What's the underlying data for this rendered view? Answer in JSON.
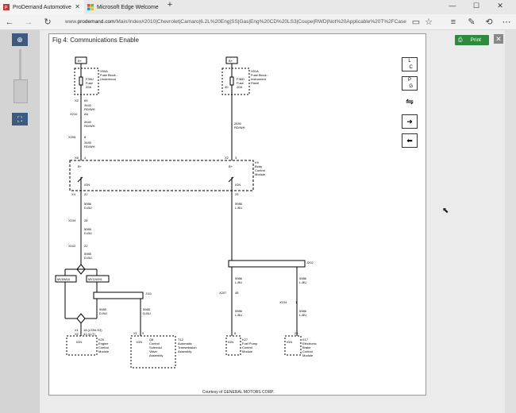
{
  "browser": {
    "tabs": [
      {
        "label": "ProDemand Automotive",
        "icon": "prodemand-icon"
      },
      {
        "label": "Microsoft Edge Welcome",
        "icon": "windows-icon"
      }
    ],
    "new_tab": "+",
    "url_prefix": "www.",
    "url_domain": "prodemand.com",
    "url_rest": "/Main/Index#2010|Chevrolet|Camaro|6.2L%20Eng|SS|Gas|Eng%20CD%20LS3|Coupe|RWD|Not%20Applicable%20T%2FCase"
  },
  "toolbar": {
    "print_label": "Print",
    "close_symbol": "✕"
  },
  "figure": {
    "title": "Fig 4: Communications Enable",
    "courtesy": "Courtesy of GENERAL MOTORS CORP."
  },
  "side_tools": [
    "LOC",
    "PEG",
    "connector-icon",
    "arrow-right-icon",
    "arrow-left-icon"
  ],
  "diagram": {
    "b_plus": "B+",
    "fuse_left": {
      "ref": "X50A",
      "desc1": "Fuse Block -",
      "desc2": "Underhood",
      "fuse_id": "F39U",
      "fuse": "Fuse",
      "amps": "20A"
    },
    "fuse_right": {
      "ref": "X51A",
      "desc1": "Fuse Block -",
      "desc2": "Instrument",
      "desc3": "Panel",
      "fuse_id": "F36D",
      "fuse": "Fuse",
      "amps": "20A",
      "pin": "40"
    },
    "left_conn": [
      {
        "conn": "X2",
        "pin": "69"
      },
      {
        "conn": "X210",
        "pin": "A5"
      },
      {
        "conn": "X206",
        "pin": "8"
      },
      {
        "conn": "X8",
        "pin": "4"
      }
    ],
    "left_wires": [
      {
        "circuit": "3440",
        "color": "RD/WH"
      },
      {
        "circuit": "3440",
        "color": "RD/WH"
      },
      {
        "circuit": "3440",
        "color": "RD/WH"
      }
    ],
    "right_wire": {
      "circuit": "2640",
      "color": "RD/WH"
    },
    "right_conn": {
      "conn": "X2",
      "pin": "3"
    },
    "k9": {
      "ref": "K9",
      "line1": "Body",
      "line2": "Control",
      "line3": "Module",
      "bplus1": "B+",
      "bplus2": "B+",
      "ign1": "IGN",
      "ign2": "IGN"
    },
    "x4": {
      "conn": "X4",
      "pin_left": "22",
      "pin_right": "25"
    },
    "wire_5986_a": {
      "circuit": "5986",
      "color": "D-BU"
    },
    "wire_5986_r": {
      "circuit": "5986",
      "color": "L-BU"
    },
    "x104": {
      "conn": "X104",
      "pin": "28"
    },
    "wire_5985_a": {
      "circuit": "5985",
      "color": "D-BU"
    },
    "x102": {
      "conn": "X102",
      "pin": "22"
    },
    "wire_5985_b": {
      "circuit": "5985",
      "color": "D-BU"
    },
    "mv5": "MV5/M10",
    "myc": "MYC/MY6",
    "j111": "J111",
    "j202": "J202",
    "wire_5985_c": {
      "circuit": "5985",
      "color": "D-BU"
    },
    "wire_5985_d": {
      "circuit": "5985",
      "color": "D-BU"
    },
    "wire_5986_b": {
      "circuit": "5986",
      "color": "L-BU"
    },
    "wire_5986_c": {
      "circuit": "5986",
      "color": "L-BU"
    },
    "x207": {
      "conn": "X207",
      "pin": "48"
    },
    "x104b": {
      "conn": "X104",
      "pin": "1"
    },
    "wire_5986_d": {
      "circuit": "5986",
      "color": "L-BU"
    },
    "wire_5986_e": {
      "circuit": "5986",
      "color": "L-BU"
    },
    "k20": {
      "ref": "K20",
      "l1": "Engine",
      "l2": "Control",
      "l3": "Module",
      "conn1": "X1",
      "conn2": "X2",
      "pin1": "18 (LS9/LS3)",
      "pin2": "41 (LLT)",
      "ign": "IGN"
    },
    "q8": {
      "ref": "Q8",
      "l1": "Control",
      "l2": "Solenoid",
      "l3": "Valve",
      "l4": "Assembly",
      "conn": "X1",
      "pin": "9",
      "ign": "IGN"
    },
    "t12": {
      "ref": "T12",
      "l1": "Automatic",
      "l2": "Transmission",
      "l3": "Assembly"
    },
    "k27": {
      "ref": "K27",
      "l1": "Fuel Pump",
      "l2": "Control",
      "l3": "Module",
      "pin": "8",
      "ign": "IGN"
    },
    "k17": {
      "ref": "K17",
      "l1": "Electronic",
      "l2": "Brake",
      "l3": "Control",
      "l4": "Module",
      "pin": "25",
      "ign": "IGN"
    }
  }
}
